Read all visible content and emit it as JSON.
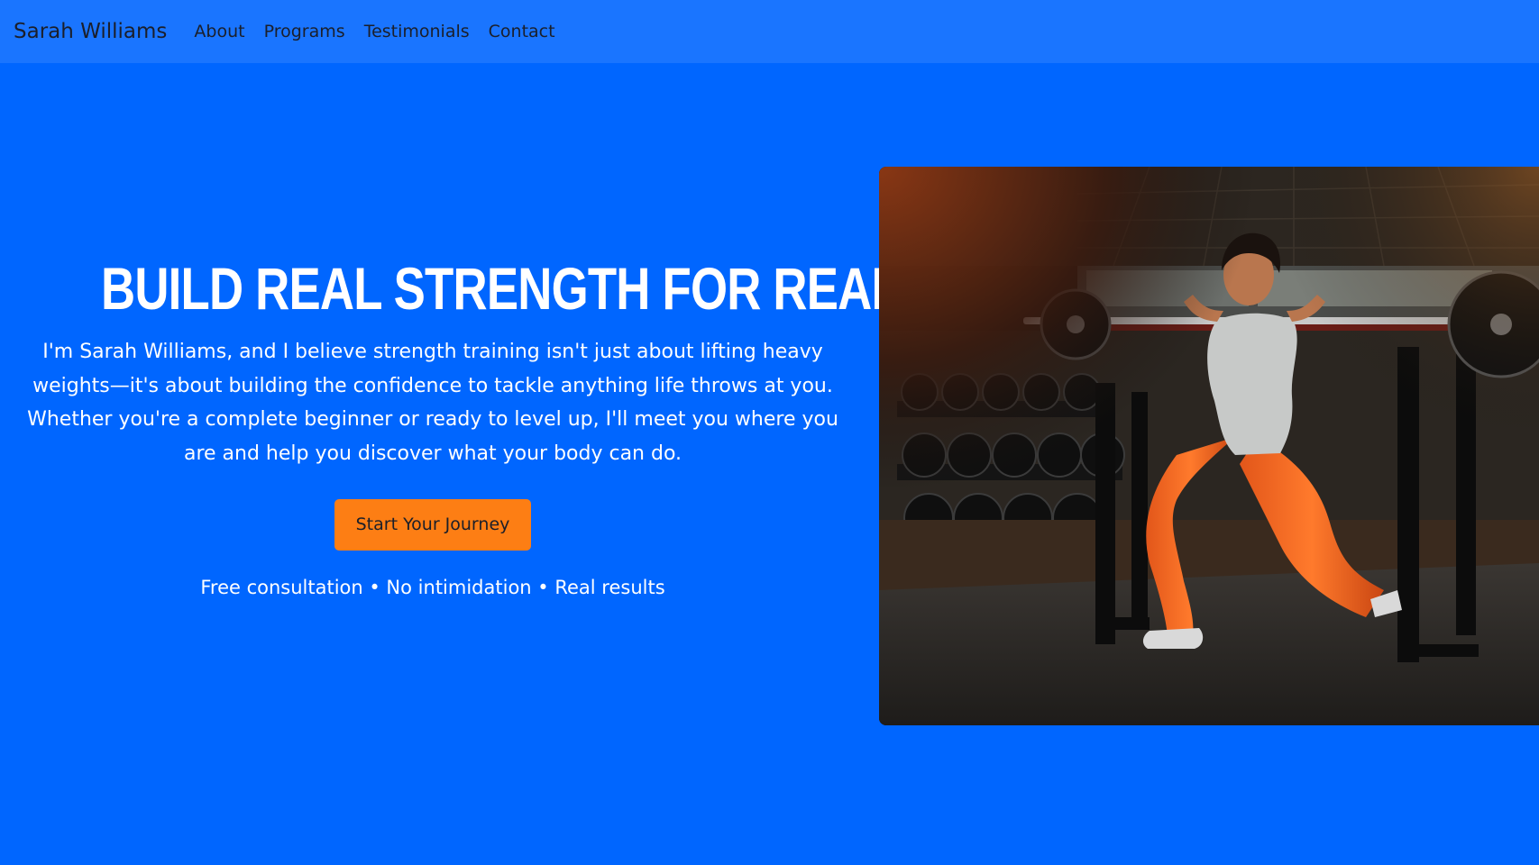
{
  "nav": {
    "brand": "Sarah Williams",
    "links": [
      {
        "label": "About"
      },
      {
        "label": "Programs"
      },
      {
        "label": "Testimonials"
      },
      {
        "label": "Contact"
      }
    ]
  },
  "hero": {
    "title": "Build Real Strength for Real Life",
    "description": "I'm Sarah Williams, and I believe strength training isn't just about lifting heavy weights—it's about building the confidence to tackle anything life throws at you. Whether you're a complete beginner or ready to level up, I'll meet you where you are and help you discover what your body can do.",
    "cta_label": "Start Your Journey",
    "note": "Free consultation • No intimidation • Real results"
  },
  "colors": {
    "background": "#0066ff",
    "navbar": "#1a75ff",
    "cta": "#fd7e14",
    "text_light": "#ffffff",
    "text_dark": "#1b1f2a"
  }
}
